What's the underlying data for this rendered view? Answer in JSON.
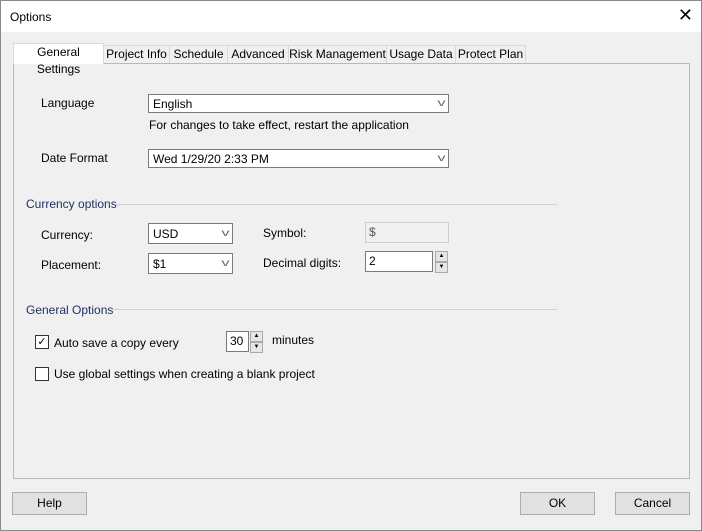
{
  "window": {
    "title": "Options",
    "close_icon": "close-icon"
  },
  "tabs": [
    {
      "label": "General Settings",
      "active": true
    },
    {
      "label": "Project Info"
    },
    {
      "label": "Schedule"
    },
    {
      "label": "Advanced"
    },
    {
      "label": "Risk Management"
    },
    {
      "label": "Usage Data"
    },
    {
      "label": "Protect Plan"
    }
  ],
  "general": {
    "language_label": "Language",
    "language_value": "English",
    "language_note": "For changes to take effect, restart the application",
    "date_format_label": "Date Format",
    "date_format_value": "Wed 1/29/20 2:33 PM"
  },
  "currency": {
    "heading": "Currency options",
    "currency_label": "Currency:",
    "currency_value": "USD",
    "placement_label": "Placement:",
    "placement_value": "$1",
    "symbol_label": "Symbol:",
    "symbol_value": "$",
    "decimal_label": "Decimal digits:",
    "decimal_value": "2"
  },
  "options": {
    "heading": "General Options",
    "autosave_label": "Auto save a copy every",
    "autosave_checked": true,
    "autosave_value": "30",
    "minutes_label": "minutes",
    "global_label": "Use global settings when creating a blank project",
    "global_checked": false
  },
  "buttons": {
    "help": "Help",
    "ok": "OK",
    "cancel": "Cancel"
  },
  "colors": {
    "group_heading": "#1e3264"
  }
}
